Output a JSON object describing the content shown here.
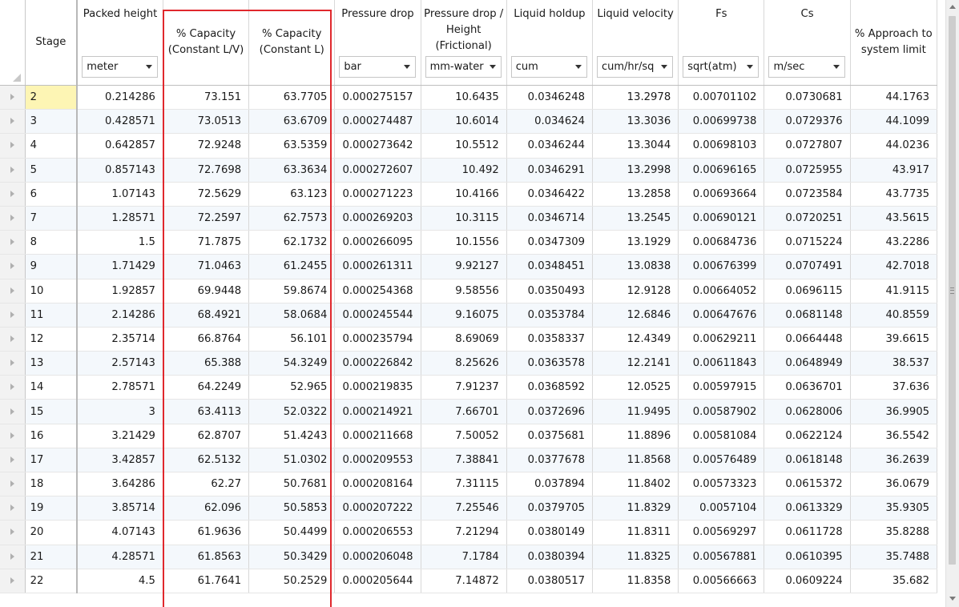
{
  "columns": [
    {
      "key": "stage",
      "line1": "Stage"
    },
    {
      "key": "packed_height",
      "line1": "Packed height",
      "unit": "meter"
    },
    {
      "key": "cap_lv",
      "line2": "% Capacity (Constant L/V)"
    },
    {
      "key": "cap_l",
      "line2": "% Capacity (Constant L)"
    },
    {
      "key": "dp",
      "line1": "Pressure drop",
      "unit": "bar"
    },
    {
      "key": "dp_h",
      "line1": "Pressure drop / Height (Frictional)",
      "unit": "mm-water"
    },
    {
      "key": "holdup",
      "line1": "Liquid holdup",
      "unit": "cum"
    },
    {
      "key": "velocity",
      "line1": "Liquid velocity",
      "unit": "cum/hr/sq"
    },
    {
      "key": "fs",
      "line1": "Fs",
      "unit": "sqrt(atm)"
    },
    {
      "key": "cs",
      "line1": "Cs",
      "unit": "m/sec"
    },
    {
      "key": "approach",
      "line2": "% Approach to system limit"
    }
  ],
  "rows": [
    [
      "2",
      "0.214286",
      "73.151",
      "63.7705",
      "0.000275157",
      "10.6435",
      "0.0346248",
      "13.2978",
      "0.00701102",
      "0.0730681",
      "44.1763"
    ],
    [
      "3",
      "0.428571",
      "73.0513",
      "63.6709",
      "0.000274487",
      "10.6014",
      "0.034624",
      "13.3036",
      "0.00699738",
      "0.0729376",
      "44.1099"
    ],
    [
      "4",
      "0.642857",
      "72.9248",
      "63.5359",
      "0.000273642",
      "10.5512",
      "0.0346244",
      "13.3044",
      "0.00698103",
      "0.0727807",
      "44.0236"
    ],
    [
      "5",
      "0.857143",
      "72.7698",
      "63.3634",
      "0.000272607",
      "10.492",
      "0.0346291",
      "13.2998",
      "0.00696165",
      "0.0725955",
      "43.917"
    ],
    [
      "6",
      "1.07143",
      "72.5629",
      "63.123",
      "0.000271223",
      "10.4166",
      "0.0346422",
      "13.2858",
      "0.00693664",
      "0.0723584",
      "43.7735"
    ],
    [
      "7",
      "1.28571",
      "72.2597",
      "62.7573",
      "0.000269203",
      "10.3115",
      "0.0346714",
      "13.2545",
      "0.00690121",
      "0.0720251",
      "43.5615"
    ],
    [
      "8",
      "1.5",
      "71.7875",
      "62.1732",
      "0.000266095",
      "10.1556",
      "0.0347309",
      "13.1929",
      "0.00684736",
      "0.0715224",
      "43.2286"
    ],
    [
      "9",
      "1.71429",
      "71.0463",
      "61.2455",
      "0.000261311",
      "9.92127",
      "0.0348451",
      "13.0838",
      "0.00676399",
      "0.0707491",
      "42.7018"
    ],
    [
      "10",
      "1.92857",
      "69.9448",
      "59.8674",
      "0.000254368",
      "9.58556",
      "0.0350493",
      "12.9128",
      "0.00664052",
      "0.0696115",
      "41.9115"
    ],
    [
      "11",
      "2.14286",
      "68.4921",
      "58.0684",
      "0.000245544",
      "9.16075",
      "0.0353784",
      "12.6846",
      "0.00647676",
      "0.0681148",
      "40.8559"
    ],
    [
      "12",
      "2.35714",
      "66.8764",
      "56.101",
      "0.000235794",
      "8.69069",
      "0.0358337",
      "12.4349",
      "0.00629211",
      "0.0664448",
      "39.6615"
    ],
    [
      "13",
      "2.57143",
      "65.388",
      "54.3249",
      "0.000226842",
      "8.25626",
      "0.0363578",
      "12.2141",
      "0.00611843",
      "0.0648949",
      "38.537"
    ],
    [
      "14",
      "2.78571",
      "64.2249",
      "52.965",
      "0.000219835",
      "7.91237",
      "0.0368592",
      "12.0525",
      "0.00597915",
      "0.0636701",
      "37.636"
    ],
    [
      "15",
      "3",
      "63.4113",
      "52.0322",
      "0.000214921",
      "7.66701",
      "0.0372696",
      "11.9495",
      "0.00587902",
      "0.0628006",
      "36.9905"
    ],
    [
      "16",
      "3.21429",
      "62.8707",
      "51.4243",
      "0.000211668",
      "7.50052",
      "0.0375681",
      "11.8896",
      "0.00581084",
      "0.0622124",
      "36.5542"
    ],
    [
      "17",
      "3.42857",
      "62.5132",
      "51.0302",
      "0.000209553",
      "7.38841",
      "0.0377678",
      "11.8568",
      "0.00576489",
      "0.0618148",
      "36.2639"
    ],
    [
      "18",
      "3.64286",
      "62.27",
      "50.7681",
      "0.000208164",
      "7.31115",
      "0.037894",
      "11.8402",
      "0.00573323",
      "0.0615372",
      "36.0679"
    ],
    [
      "19",
      "3.85714",
      "62.096",
      "50.5853",
      "0.000207222",
      "7.25546",
      "0.0379705",
      "11.8329",
      "0.0057104",
      "0.0613329",
      "35.9305"
    ],
    [
      "20",
      "4.07143",
      "61.9636",
      "50.4499",
      "0.000206553",
      "7.21294",
      "0.0380149",
      "11.8311",
      "0.00569297",
      "0.0611728",
      "35.8288"
    ],
    [
      "21",
      "4.28571",
      "61.8563",
      "50.3429",
      "0.000206048",
      "7.1784",
      "0.0380394",
      "11.8325",
      "0.00567881",
      "0.0610395",
      "35.7488"
    ],
    [
      "22",
      "4.5",
      "61.7641",
      "50.2529",
      "0.000205644",
      "7.14872",
      "0.0380517",
      "11.8358",
      "0.00566663",
      "0.0609224",
      "35.682"
    ]
  ],
  "current_row": 0,
  "colors": {
    "highlight_box": "#e0282d",
    "current_stage_cell": "#fdf5b4",
    "alt_row": "#f4f8fc"
  }
}
